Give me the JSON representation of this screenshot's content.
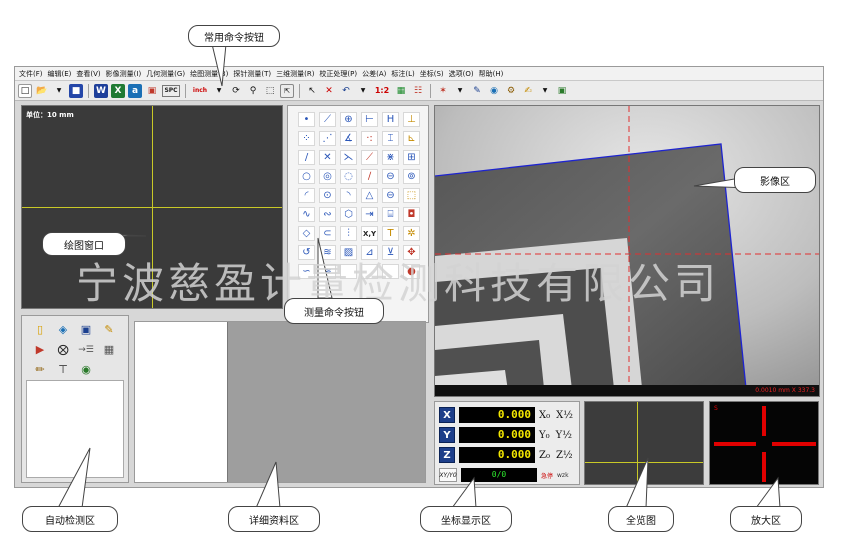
{
  "menubar": {
    "items": [
      "文件(F)",
      "编辑(E)",
      "查看(V)",
      "影像测量(I)",
      "几何测量(G)",
      "绘图测量(B)",
      "探针测量(T)",
      "三维测量(R)",
      "校正处理(P)",
      "公差(A)",
      "标注(L)",
      "坐标(S)",
      "选项(O)",
      "帮助(H)"
    ]
  },
  "toolbar": {
    "spc_label": "SPC",
    "inch_label": "inch",
    "scale_label": "1:2"
  },
  "drawing": {
    "unit_label": "单位：10 mm"
  },
  "palette": {
    "xy_label": "X,Y",
    "text_label": "T"
  },
  "image_status": {
    "text": "0.0010 mm   X 337.3"
  },
  "coord": {
    "x_axis": "X",
    "y_axis": "Y",
    "z_axis": "Z",
    "x_value": "0.000",
    "y_value": "0.000",
    "z_value": "0.000",
    "x_zero": "X₀",
    "y_zero": "Y₀",
    "z_zero": "Z₀",
    "x_half": "X½",
    "y_half": "Y½",
    "z_half": "Z½",
    "xy_btn": "XY/Y0",
    "count": "0/0",
    "stop_label": "急停",
    "wzk_label": "wzk"
  },
  "magnify": {
    "mark": "S"
  },
  "callouts": {
    "common_cmd": "常用命令按钮",
    "image_area": "影像区",
    "drawing_window": "绘图窗口",
    "measure_cmd": "测量命令按钮",
    "auto_detect": "自动检测区",
    "detail_data": "详细资料区",
    "coord_display": "坐标显示区",
    "overview": "全览图",
    "magnify": "放大区"
  },
  "watermark": "宁波慈盈计量检测科技有限公司",
  "colors": {
    "crosshair": "#c9c927",
    "magnify_cross": "#e10000",
    "axis_box": "#1d3e8a",
    "digit": "#f2e600"
  }
}
